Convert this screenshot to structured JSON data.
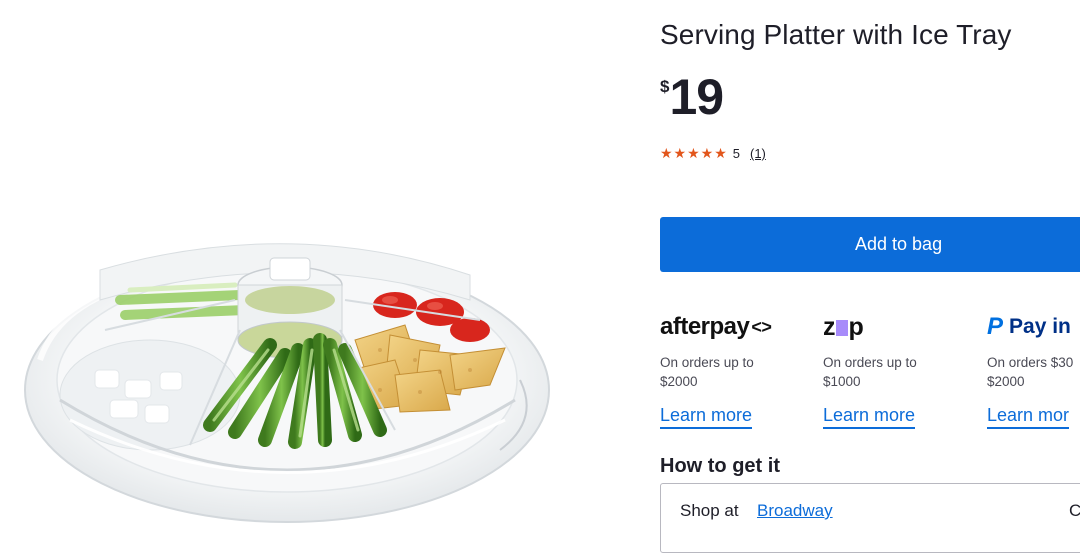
{
  "product": {
    "title": "Serving Platter with Ice Tray",
    "price_currency": "$",
    "price_amount": "19",
    "rating_stars": "★★★★★",
    "rating_value": "5",
    "rating_count": "(1)"
  },
  "actions": {
    "add_to_bag": "Add to bag"
  },
  "payments": [
    {
      "logo_text": "afterpay",
      "logo_mark": "<>",
      "desc": "On orders up to\n$2000",
      "link": "Learn more"
    },
    {
      "logo_left": "z",
      "logo_right": "p",
      "desc": "On orders up to\n$1000",
      "link": "Learn more"
    },
    {
      "logo_mark": "P",
      "logo_text": "Pay in",
      "desc": "On orders $30\n$2000",
      "link": "Learn mor"
    }
  ],
  "delivery": {
    "heading": "How to get it",
    "shop_label": "Shop at",
    "store_name": "Broadway",
    "right_text": "C"
  },
  "colors": {
    "accent": "#0c6cd9",
    "star": "#e2561c",
    "text": "#1e1e28",
    "zip_purple": "#a78bfa",
    "paypal_dark": "#003087",
    "paypal_light": "#0070e0"
  },
  "icons": {
    "afterpay": "afterpay-logo",
    "zip": "zip-logo",
    "paypal": "paypal-logo"
  }
}
